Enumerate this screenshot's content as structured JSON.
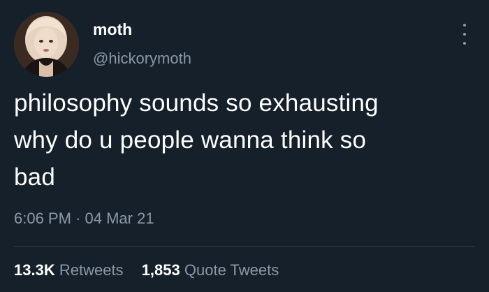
{
  "user": {
    "display_name": "moth",
    "handle": "@hickorymoth"
  },
  "tweet": {
    "lines": [
      "philosophy sounds so exhausting",
      "why do u people wanna think so",
      "bad"
    ],
    "time": "6:06 PM",
    "separator": "·",
    "date": "04 Mar 21"
  },
  "stats": {
    "retweets_count": "13.3K",
    "retweets_label": "Retweets",
    "quotes_count": "1,853",
    "quotes_label": "Quote Tweets"
  },
  "icons": {
    "more": "more-options-icon"
  },
  "colors": {
    "background": "#15202b",
    "primary_text": "#ffffff",
    "secondary_text": "#8b98a5",
    "divider": "#2f3c48"
  }
}
